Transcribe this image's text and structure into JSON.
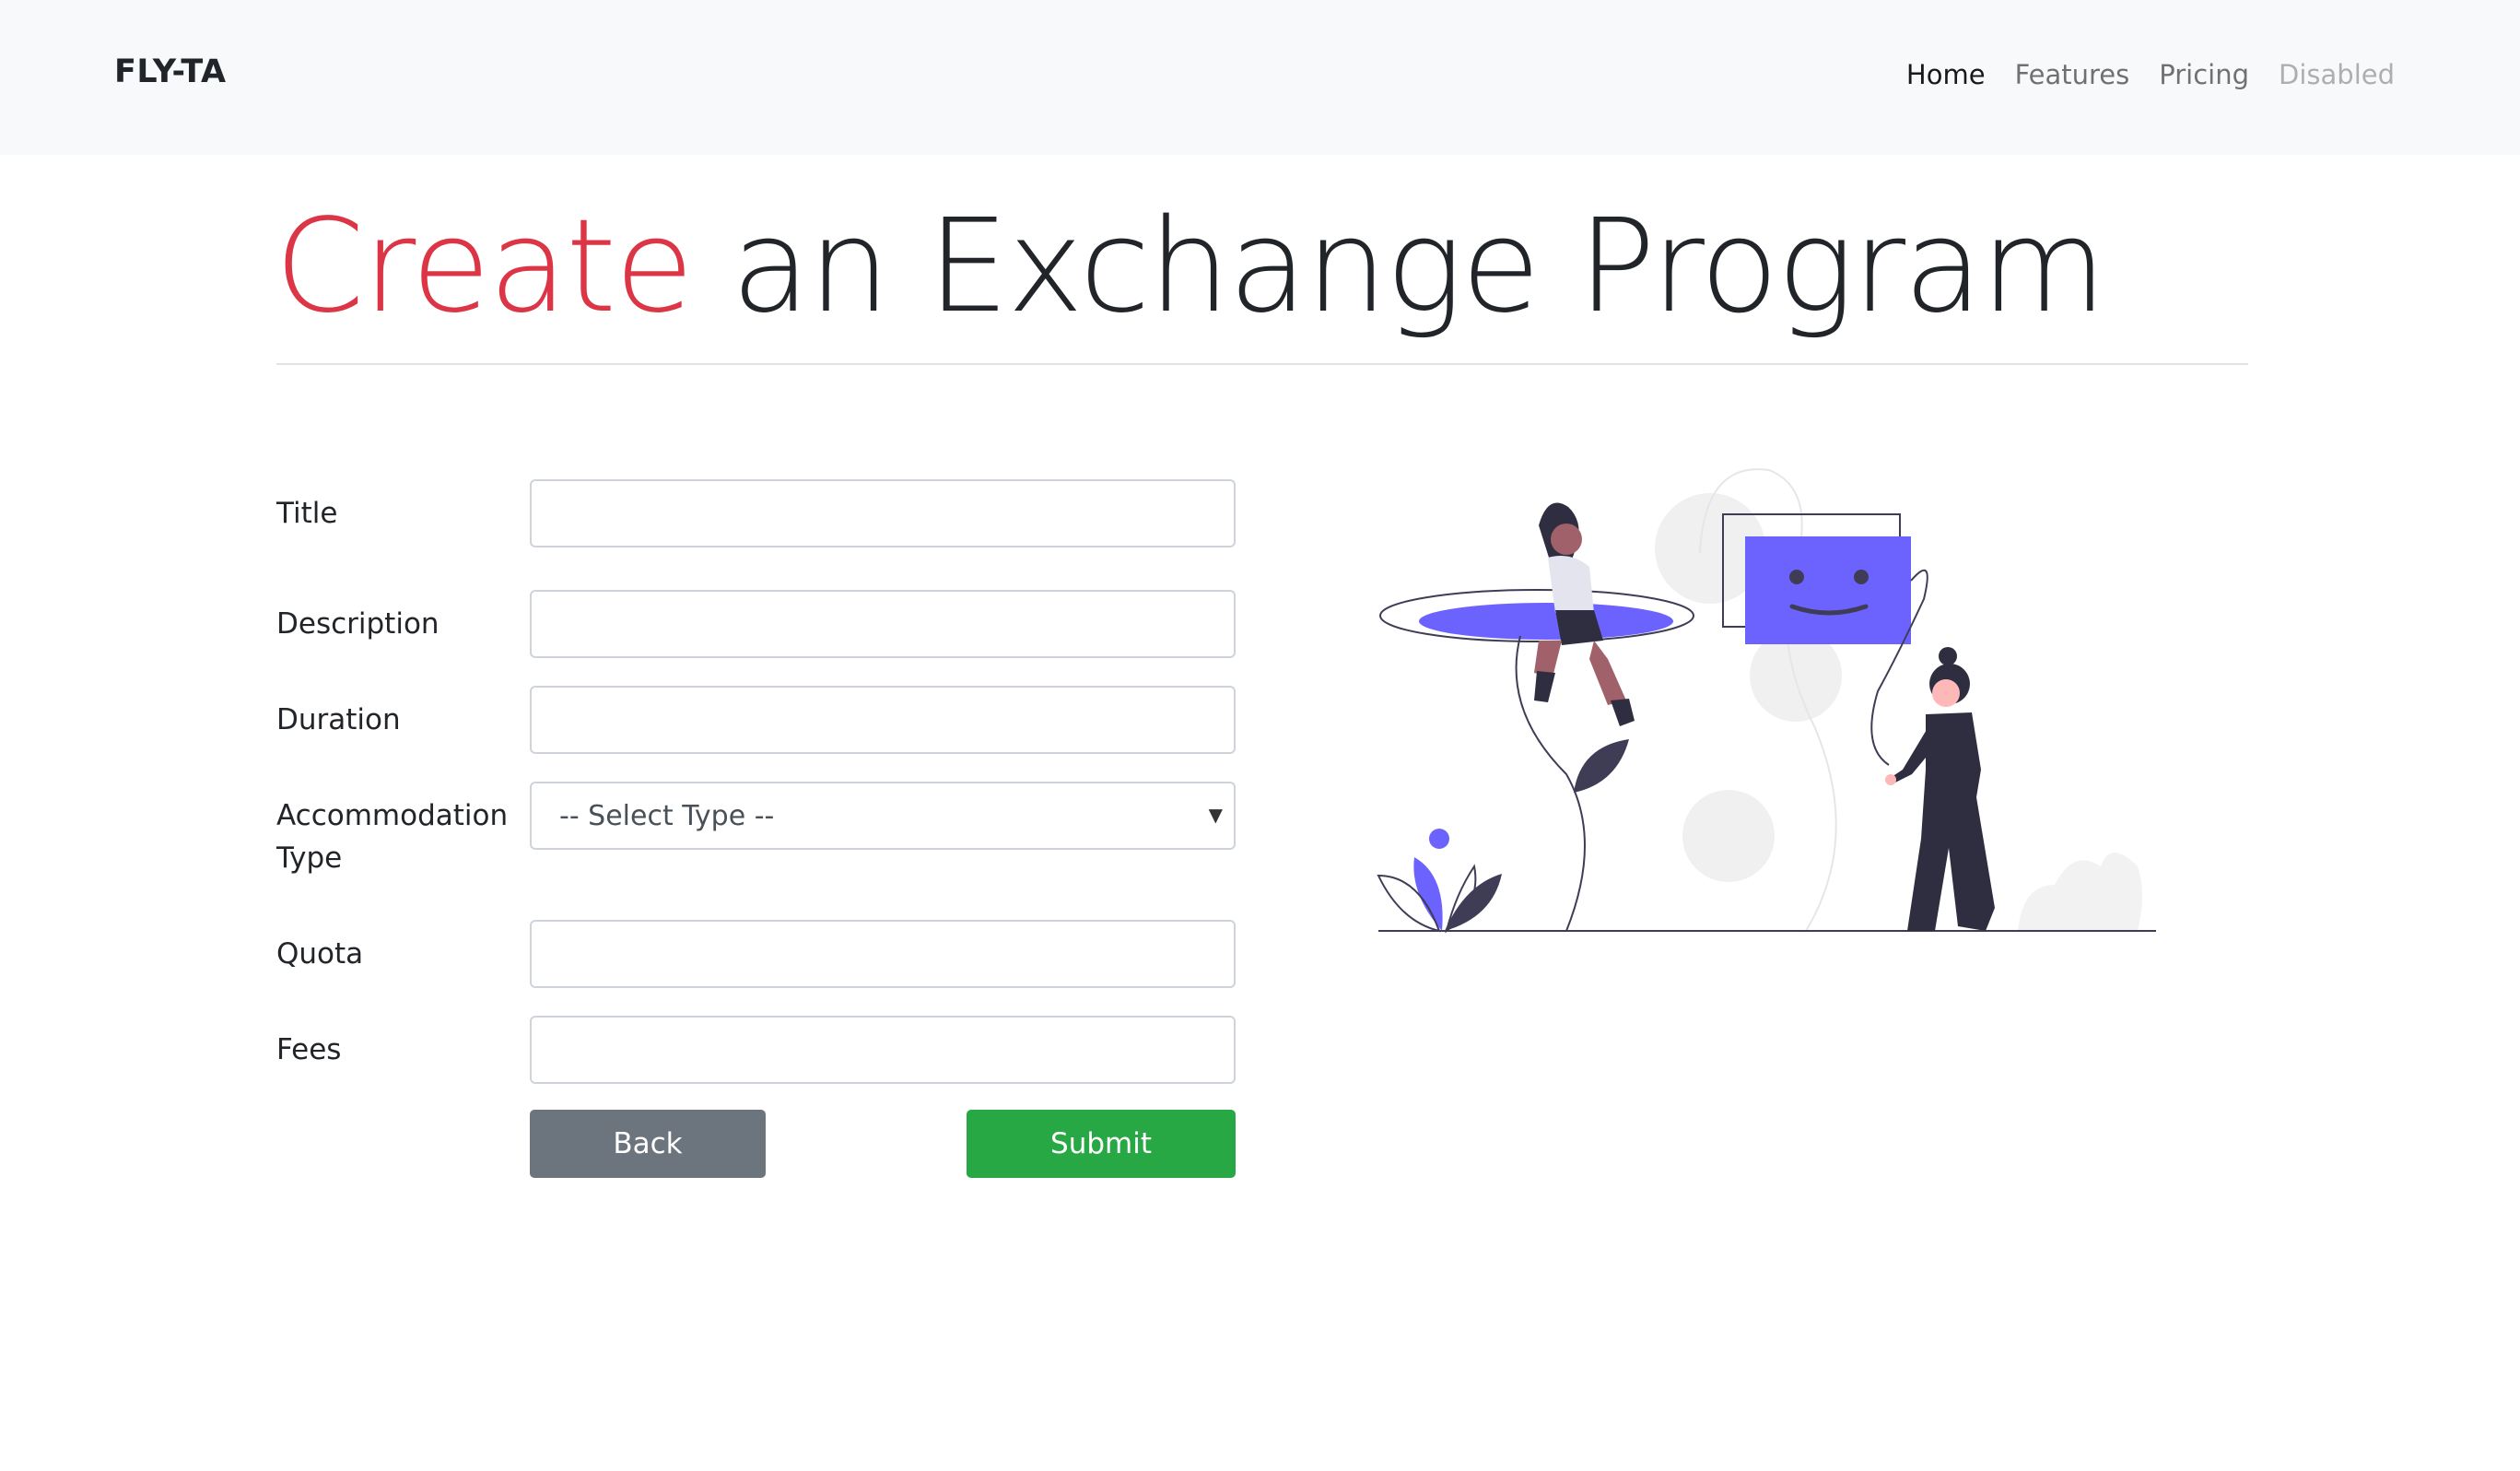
{
  "navbar": {
    "brand": "FLY-TA",
    "links": [
      {
        "label": "Home",
        "state": "active"
      },
      {
        "label": "Features",
        "state": "normal"
      },
      {
        "label": "Pricing",
        "state": "normal"
      },
      {
        "label": "Disabled",
        "state": "disabled"
      }
    ]
  },
  "heading": {
    "accent": "Create",
    "rest": " an Exchange Program"
  },
  "form": {
    "title_label": "Title",
    "title_value": "",
    "description_label": "Description",
    "description_value": "",
    "duration_label": "Duration",
    "duration_value": "",
    "accommodation_label_line1": "Accommodation",
    "accommodation_label_line2": "Type",
    "accommodation_selected": "-- Select Type --",
    "quota_label": "Quota",
    "quota_value": "",
    "fees_label": "Fees",
    "fees_value": "",
    "back_label": "Back",
    "submit_label": "Submit"
  },
  "colors": {
    "accent": "#dc3545",
    "illustration_primary": "#6c63ff",
    "illustration_dark": "#2f2e41",
    "submit": "#28a745",
    "back": "#6c757d",
    "navbar_bg": "#f8f9fa"
  }
}
